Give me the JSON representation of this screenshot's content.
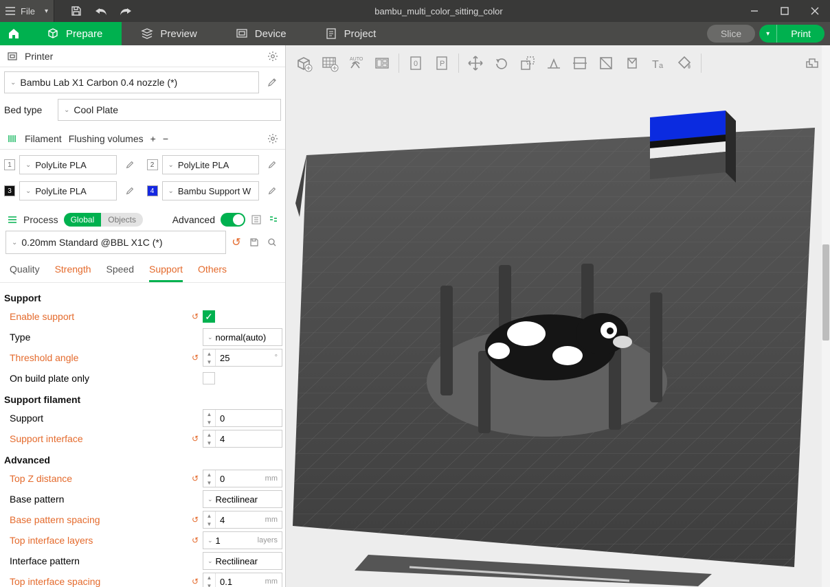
{
  "titlebar": {
    "file_menu": "File",
    "title": "bambu_multi_color_sitting_color"
  },
  "nav": {
    "prepare": "Prepare",
    "preview": "Preview",
    "device": "Device",
    "project": "Project",
    "slice": "Slice",
    "print": "Print"
  },
  "printer": {
    "section": "Printer",
    "profile": "Bambu Lab X1 Carbon 0.4 nozzle (*)",
    "bedtype_label": "Bed type",
    "bedtype_value": "Cool Plate"
  },
  "filament": {
    "section": "Filament",
    "flushing": "Flushing volumes",
    "items": [
      {
        "num": "1",
        "name": "PolyLite PLA",
        "color": "sw-white"
      },
      {
        "num": "2",
        "name": "PolyLite PLA",
        "color": "sw-white sw-redtxt"
      },
      {
        "num": "3",
        "name": "PolyLite PLA",
        "color": "sw-black"
      },
      {
        "num": "4",
        "name": "Bambu Support W",
        "color": "sw-blue"
      }
    ]
  },
  "process": {
    "section": "Process",
    "seg_global": "Global",
    "seg_objects": "Objects",
    "advanced": "Advanced",
    "profile": "0.20mm Standard @BBL X1C (*)",
    "tabs": {
      "quality": "Quality",
      "strength": "Strength",
      "speed": "Speed",
      "support": "Support",
      "others": "Others"
    }
  },
  "support": {
    "hdr_support": "Support",
    "enable_support": "Enable support",
    "type": "Type",
    "type_value": "normal(auto)",
    "threshold_angle": "Threshold angle",
    "threshold_angle_value": "25",
    "threshold_angle_unit": "°",
    "on_build_plate": "On build plate only",
    "hdr_filament": "Support filament",
    "support_fil": "Support",
    "support_fil_value": "0",
    "support_interface": "Support interface",
    "support_interface_value": "4",
    "hdr_advanced": "Advanced",
    "top_z": "Top Z distance",
    "top_z_value": "0",
    "top_z_unit": "mm",
    "base_pattern": "Base pattern",
    "base_pattern_value": "Rectilinear",
    "base_spacing": "Base pattern spacing",
    "base_spacing_value": "4",
    "base_spacing_unit": "mm",
    "top_layers": "Top interface layers",
    "top_layers_value": "1",
    "top_layers_unit": "layers",
    "interface_pattern": "Interface pattern",
    "interface_pattern_value": "Rectilinear",
    "top_interface_spacing": "Top interface spacing",
    "top_interface_spacing_value": "0.1",
    "top_interface_spacing_unit": "mm"
  }
}
